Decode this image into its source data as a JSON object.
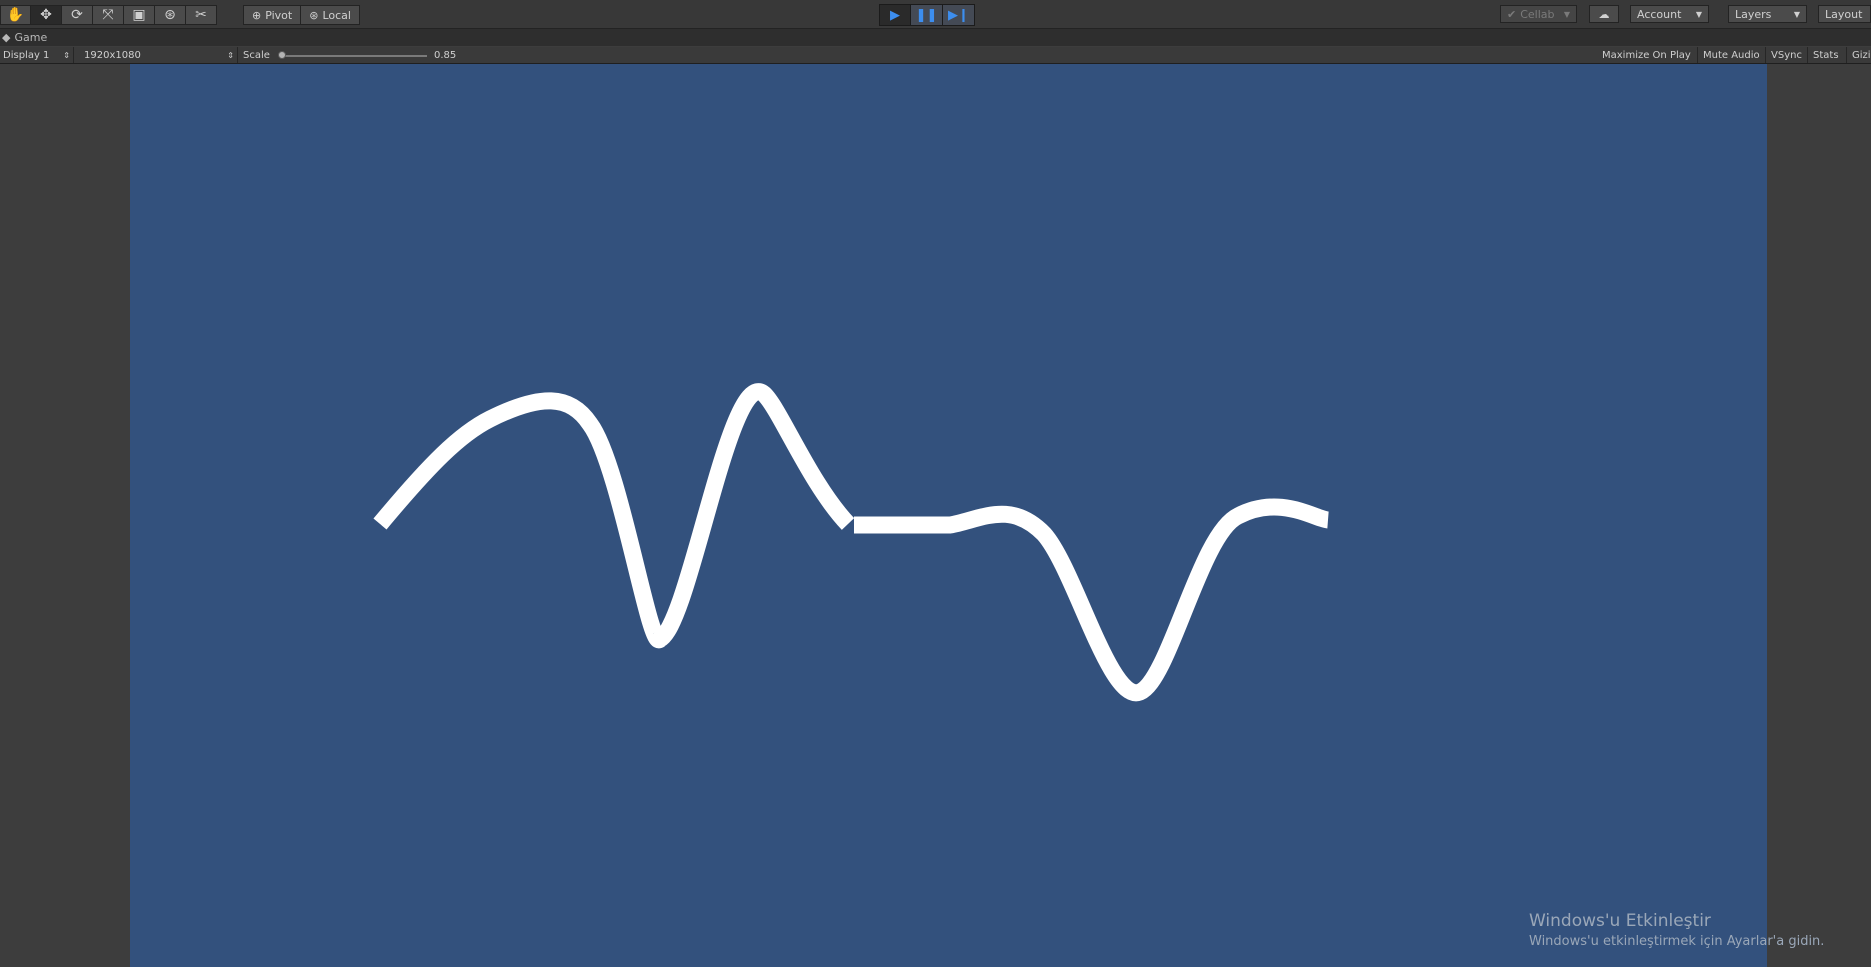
{
  "toolbar": {
    "tools": [
      {
        "icon": "hand-icon",
        "glyph": "✋"
      },
      {
        "icon": "move-icon",
        "glyph": "✥"
      },
      {
        "icon": "rotate-icon",
        "glyph": "⟳"
      },
      {
        "icon": "scale-icon",
        "glyph": "⤧"
      },
      {
        "icon": "rect-icon",
        "glyph": "▣"
      },
      {
        "icon": "transform-icon",
        "glyph": "⊛"
      },
      {
        "icon": "custom-tool-icon",
        "glyph": "✂"
      }
    ],
    "pivot_label": "Pivot",
    "local_label": "Local",
    "cellab_label": "Cellab",
    "account_label": "Account",
    "layers_label": "Layers",
    "layout_label": "Layout"
  },
  "tab": {
    "label": "Game"
  },
  "gamebar": {
    "display": "Display 1",
    "resolution": "1920x1080",
    "scale_label": "Scale",
    "scale_value": "0.85",
    "scale_fraction": 0.0,
    "maximize": "Maximize On Play",
    "mute": "Mute Audio",
    "vsync": "VSync",
    "stats": "Stats",
    "gizmos": "Gizi"
  },
  "colors": {
    "viewport_bg": "#33517d",
    "line": "#ffffff",
    "play_blue": "#3c8ef0"
  },
  "watermark": {
    "title": "Windows'u Etkinleştir",
    "subtitle": "Windows'u etkinleştirmek için Ayarlar'a gidin."
  }
}
